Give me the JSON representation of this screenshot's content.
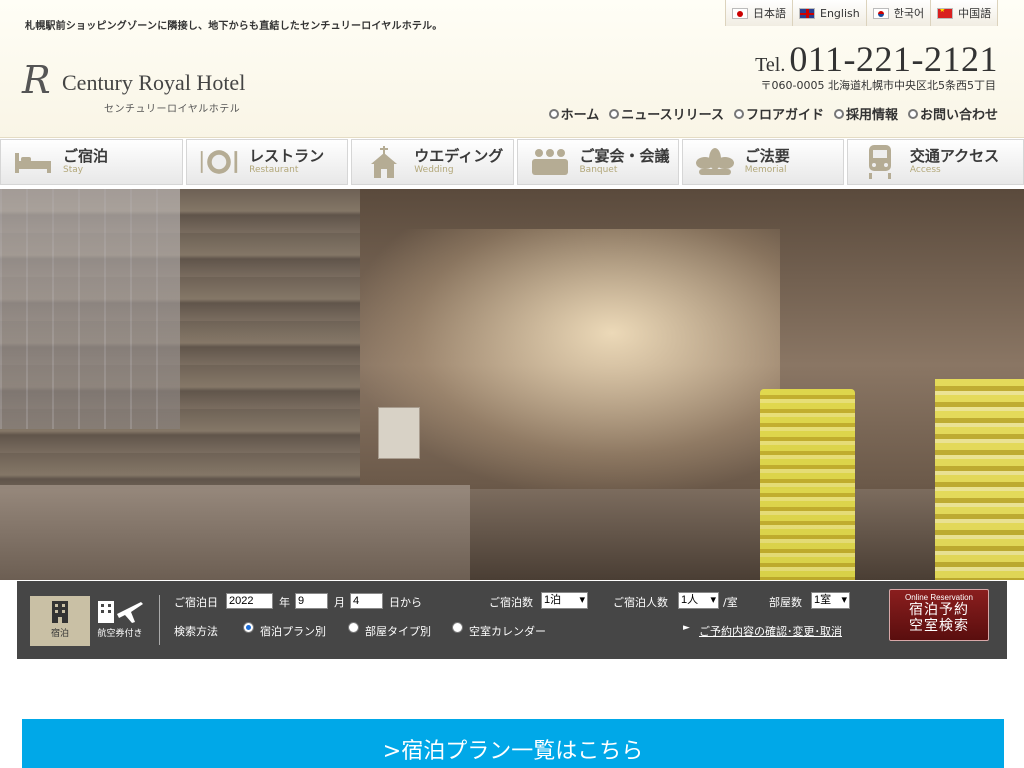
{
  "header": {
    "tagline": "札幌駅前ショッピングゾーンに隣接し、地下からも直結したセンチュリーロイヤルホテル。",
    "logo_mark": "R",
    "logo_name": "Century Royal Hotel",
    "logo_kana": "センチュリーロイヤルホテル",
    "tel_label": "Tel.",
    "tel_number": "011-221-2121",
    "address": "〒060-0005 北海道札幌市中央区北5条西5丁目"
  },
  "languages": [
    {
      "label": "日本語",
      "icon": "flag-jp-icon"
    },
    {
      "label": "English",
      "icon": "flag-en-icon"
    },
    {
      "label": "한국어",
      "icon": "flag-ko-icon"
    },
    {
      "label": "中国語",
      "icon": "flag-cn-icon"
    }
  ],
  "subnav": [
    {
      "label": "ホーム"
    },
    {
      "label": "ニュースリリース"
    },
    {
      "label": "フロアガイド"
    },
    {
      "label": "採用情報"
    },
    {
      "label": "お問い合わせ"
    }
  ],
  "mainnav": [
    {
      "ja": "ご宿泊",
      "en": "Stay",
      "icon": "bed-icon"
    },
    {
      "ja": "レストラン",
      "en": "Restaurant",
      "icon": "plate-icon"
    },
    {
      "ja": "ウエディング",
      "en": "Wedding",
      "icon": "chapel-icon"
    },
    {
      "ja": "ご宴会・会議",
      "en": "Banquet",
      "icon": "banquet-icon"
    },
    {
      "ja": "ご法要",
      "en": "Memorial",
      "icon": "lotus-icon"
    },
    {
      "ja": "交通アクセス",
      "en": "Access",
      "icon": "train-icon"
    }
  ],
  "booking": {
    "tab_stay": "宿泊",
    "tab_air": "航空券付き",
    "checkin_label": "ご宿泊日",
    "year": "2022",
    "year_unit": "年",
    "month": "9",
    "month_unit": "月",
    "day": "4",
    "day_unit": "日から",
    "nights_label": "ご宿泊数",
    "nights_value": "1泊",
    "guests_label": "ご宿泊人数",
    "guests_value": "1人",
    "guests_unit": "/室",
    "rooms_label": "部屋数",
    "rooms_value": "1室",
    "search_method_label": "検索方法",
    "radio_plan": "宿泊プラン別",
    "radio_room": "部屋タイプ別",
    "radio_calendar": "空室カレンダー",
    "confirm_link": "ご予約内容の確認･変更･取消",
    "btn_sub": "Online Reservation",
    "btn_line1": "宿泊予約",
    "btn_line2": "空室検索"
  },
  "plans_banner": ">宿泊プラン一覧はこちら",
  "colors": {
    "header_bg": "#fdfaef",
    "booking_bg": "#464646",
    "reserve_btn": "#7a1818",
    "banner": "#00a8e8",
    "nav_en": "#b3a87a"
  }
}
